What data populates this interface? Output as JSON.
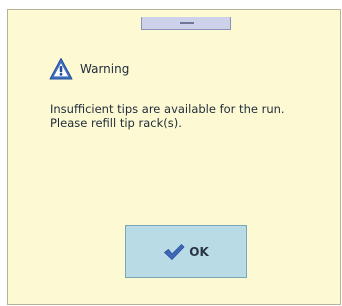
{
  "dialog": {
    "title": "Warning",
    "icon": "warning-icon",
    "message_lines": [
      "Insufficient tips are available for the run.",
      "Please refill tip rack(s)."
    ],
    "ok_button": {
      "label": "OK",
      "icon": "check-icon"
    }
  },
  "colors": {
    "background": "#fdfad3",
    "warning_icon": "#3b6fc2",
    "ok_button": "#b9dbe6",
    "check_icon": "#3d67b8",
    "text": "#1f2a3a"
  }
}
